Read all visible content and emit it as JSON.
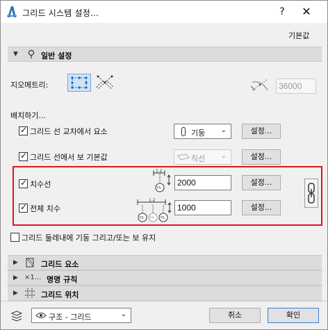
{
  "window": {
    "title": "그리드 시스템 설정...",
    "help": "?",
    "close": "✕"
  },
  "favorites": "기본값",
  "general": {
    "header": "일반 설정",
    "geometry_label": "지오메트리:",
    "geometry_value": "36000",
    "placement_label": "배치하기...",
    "col_at_intersection": "그리드 선 교차에서 요소",
    "col_dropdown": "기둥",
    "beam_on_lines": "그리드 선에서 보 기본값",
    "beam_dropdown": "직선",
    "settings_label": "설정..."
  },
  "dimensions": {
    "dim_lines": "치수선",
    "dim_lines_value": "2000",
    "overall_dim": "전체 치수",
    "overall_dim_value": "1000",
    "settings_label": "설정...",
    "ys_label": "YS",
    "tick_label": "1.2"
  },
  "keep_within": "그리드 둘레내에 기둥 그리고/또는 보 유지",
  "sections": {
    "grid_elements": "그리드 요소",
    "naming_prefix": "×1...",
    "naming": "명명 규칙",
    "grid_position": "그리드 위치"
  },
  "footer": {
    "layer": "구조 - 그리드",
    "cancel": "취소",
    "ok": "확인"
  }
}
